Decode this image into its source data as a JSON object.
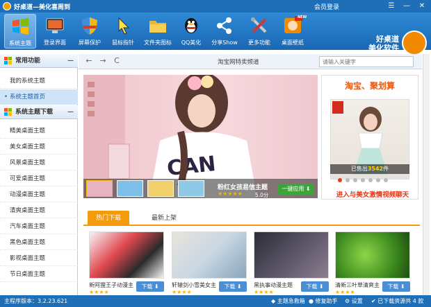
{
  "window": {
    "title": "好桌道—美化喜周到",
    "login": "会员登录",
    "controls": [
      "☰",
      "—",
      "✕"
    ]
  },
  "toolbar": {
    "items": [
      {
        "label": "系统主题",
        "icon": "windows-flag-icon",
        "active": true
      },
      {
        "label": "登录界面",
        "icon": "monitor-icon",
        "active": false
      },
      {
        "label": "屏幕保护",
        "icon": "shield-icon",
        "active": false
      },
      {
        "label": "鼠标指针",
        "icon": "cursor-icon",
        "active": false
      },
      {
        "label": "文件夹图标",
        "icon": "folder-icon",
        "active": false
      },
      {
        "label": "QQ美化",
        "icon": "qq-penguin-icon",
        "active": false
      },
      {
        "label": "分享Show",
        "icon": "share-icon",
        "active": false
      },
      {
        "label": "更多功能",
        "icon": "tools-icon",
        "active": false
      },
      {
        "label": "桌面壁纸",
        "icon": "wallpaper-icon",
        "active": false
      }
    ],
    "new_badge": "NEW",
    "brand_line1": "好桌道",
    "brand_line2": "美化软件"
  },
  "sidebar": {
    "section1": "常用功能",
    "common_items": [
      "我的系统主题",
      "系统主题首页"
    ],
    "section2": "系统主题下载",
    "download_items": [
      "精美桌面主题",
      "美女桌面主题",
      "风景桌面主题",
      "可爱桌面主题",
      "动漫桌面主题",
      "清爽桌面主题",
      "汽车桌面主题",
      "黑色桌面主题",
      "影视桌面主题",
      "节日桌面主题"
    ],
    "collapse": "—"
  },
  "nav": {
    "back": "←",
    "forward": "→",
    "refresh": "C",
    "title": "淘宝网特卖频道",
    "search_placeholder": "请输入关键字"
  },
  "banner": {
    "title": "粉红女孩易信主题",
    "stars": "★★★★★",
    "rating": "5.0分",
    "apply": "一键应用 ⬇"
  },
  "taobao": {
    "header": "淘宝、聚划算",
    "sold_prefix": "已售出",
    "sold_count": "3542",
    "sold_suffix": "件",
    "promo": "进入与美女激情视频聊天"
  },
  "tabs": [
    "热门下载",
    "最新上架"
  ],
  "cards": [
    {
      "name": "新阿狸王子动漫主",
      "stars": "★★★★",
      "download": "下载 ⬇"
    },
    {
      "name": "轩辕剑小雪美女主",
      "stars": "★★★★",
      "download": "下载 ⬇"
    },
    {
      "name": "黑执事动漫主题",
      "stars": "★★★★",
      "download": "下载 ⬇"
    },
    {
      "name": "清新三叶草清爽主",
      "stars": "★★★★",
      "download": "下载 ⬇"
    }
  ],
  "status": {
    "version": "主程序版本：3.2.23.621",
    "items": [
      "主题急救箱",
      "修复助手",
      "设置",
      "已下载资源共 4 款"
    ]
  }
}
